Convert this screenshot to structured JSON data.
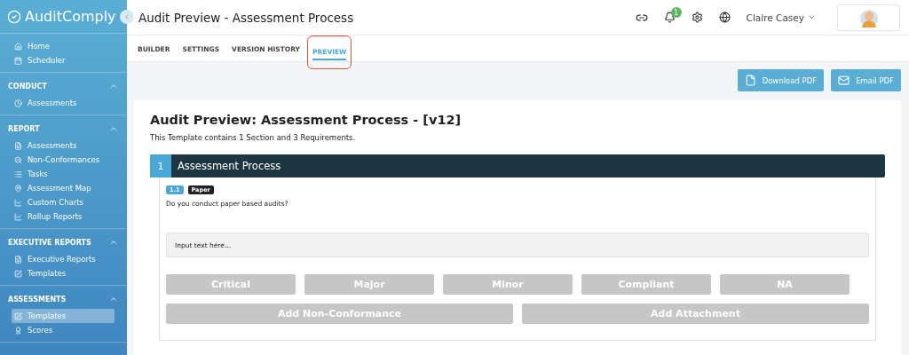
{
  "sidebar": {
    "logo": "AuditComply",
    "sections": [
      {
        "items": [
          {
            "label": "Home",
            "kind": "home",
            "selected": false
          },
          {
            "label": "Scheduler",
            "kind": "calendar",
            "selected": false
          }
        ]
      },
      {
        "heading": "CONDUCT",
        "expanded": true,
        "items": [
          {
            "label": "Assessments",
            "kind": "clock",
            "selected": false
          }
        ]
      },
      {
        "heading": "REPORT",
        "expanded": true,
        "items": [
          {
            "label": "Assessments",
            "kind": "report",
            "selected": false
          },
          {
            "label": "Non-Conformances",
            "kind": "search",
            "selected": false
          },
          {
            "label": "Tasks",
            "kind": "list",
            "selected": false
          },
          {
            "label": "Assessment Map",
            "kind": "pin",
            "selected": false
          },
          {
            "label": "Custom Charts",
            "kind": "chart",
            "selected": false
          },
          {
            "label": "Rollup Reports",
            "kind": "chart",
            "selected": false
          }
        ]
      },
      {
        "heading": "EXECUTIVE REPORTS",
        "expanded": true,
        "items": [
          {
            "label": "Executive Reports",
            "kind": "report",
            "selected": false
          },
          {
            "label": "Templates",
            "kind": "edit",
            "selected": false
          }
        ]
      },
      {
        "heading": "ASSESSMENTS",
        "expanded": true,
        "items": [
          {
            "label": "Templates",
            "kind": "edit",
            "selected": true
          },
          {
            "label": "Scores",
            "kind": "award",
            "selected": false
          }
        ]
      }
    ]
  },
  "header": {
    "title": "Audit Preview - Assessment Process",
    "notification_count": "1",
    "user": "Claire Casey"
  },
  "tabs": [
    {
      "label": "BUILDER",
      "selected": false,
      "highlighted": false
    },
    {
      "label": "SETTINGS",
      "selected": false,
      "highlighted": false
    },
    {
      "label": "VERSION HISTORY",
      "selected": false,
      "highlighted": false
    },
    {
      "label": "PREVIEW",
      "selected": true,
      "highlighted": true
    }
  ],
  "actions": [
    {
      "label": "Download PDF",
      "kind": "file"
    },
    {
      "label": "Email PDF",
      "kind": "mail"
    }
  ],
  "preview": {
    "title": "Audit Preview: Assessment Process - [v12]",
    "summary": "This Template contains 1 Section and 3 Requirements.",
    "section": {
      "number": "1",
      "title": "Assessment Process"
    },
    "requirement": {
      "number": "1.1",
      "tag": "Paper",
      "question": "Do you conduct paper based audits?",
      "placeholder": "Input text here...",
      "ratings": [
        "Critical",
        "Major",
        "Minor",
        "Compliant",
        "NA"
      ],
      "extras": [
        "Add Non-Conformance",
        "Add Attachment"
      ]
    }
  }
}
